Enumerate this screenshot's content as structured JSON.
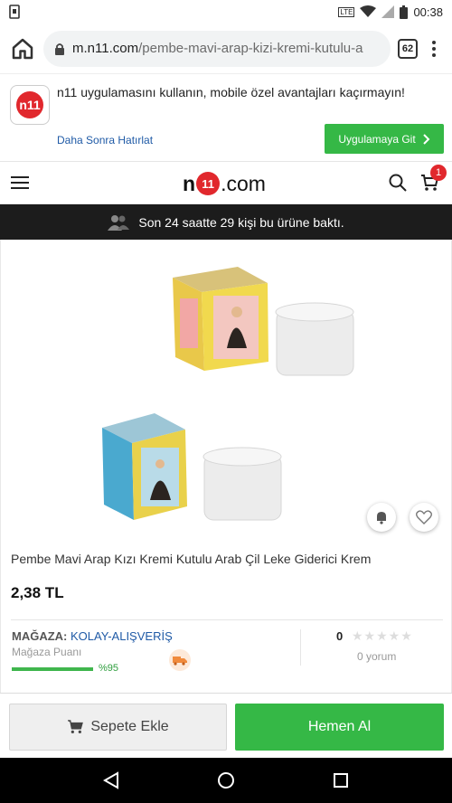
{
  "status_bar": {
    "time": "00:38"
  },
  "browser": {
    "url_domain": "m.n11.com",
    "url_path": "/pembe-mavi-arap-kizi-kremi-kutulu-a",
    "tab_count": "62"
  },
  "promo": {
    "app_logo_text": "n11",
    "message": "n11 uygulamasını kullanın, mobile özel avantajları kaçırmayın!",
    "later_link": "Daha Sonra Hatırlat",
    "go_button": "Uygulamaya Git"
  },
  "header": {
    "logo_n": "n",
    "logo_11": "11",
    "logo_dotcom": ".com",
    "cart_count": "1"
  },
  "viewers_banner": {
    "text": "Son 24 saatte 29 kişi bu ürüne baktı."
  },
  "product": {
    "title": "Pembe Mavi Arap Kızı Kremi Kutulu Arab Çil Leke Giderici Krem",
    "price": "2,38 TL"
  },
  "store": {
    "label": "MAĞAZA:",
    "name": "KOLAY-ALIŞVERİŞ",
    "score_label": "Mağaza Puanı",
    "score_percent": "%95",
    "score_value": 0.95,
    "rating": "0",
    "stars_filled": 0,
    "stars_total": 5,
    "reviews": "0 yorum"
  },
  "actions": {
    "add_to_cart": "Sepete Ekle",
    "buy_now": "Hemen Al"
  },
  "colors": {
    "brand_red": "#e1282d",
    "green": "#35b846",
    "link_blue": "#1f5aa6"
  }
}
